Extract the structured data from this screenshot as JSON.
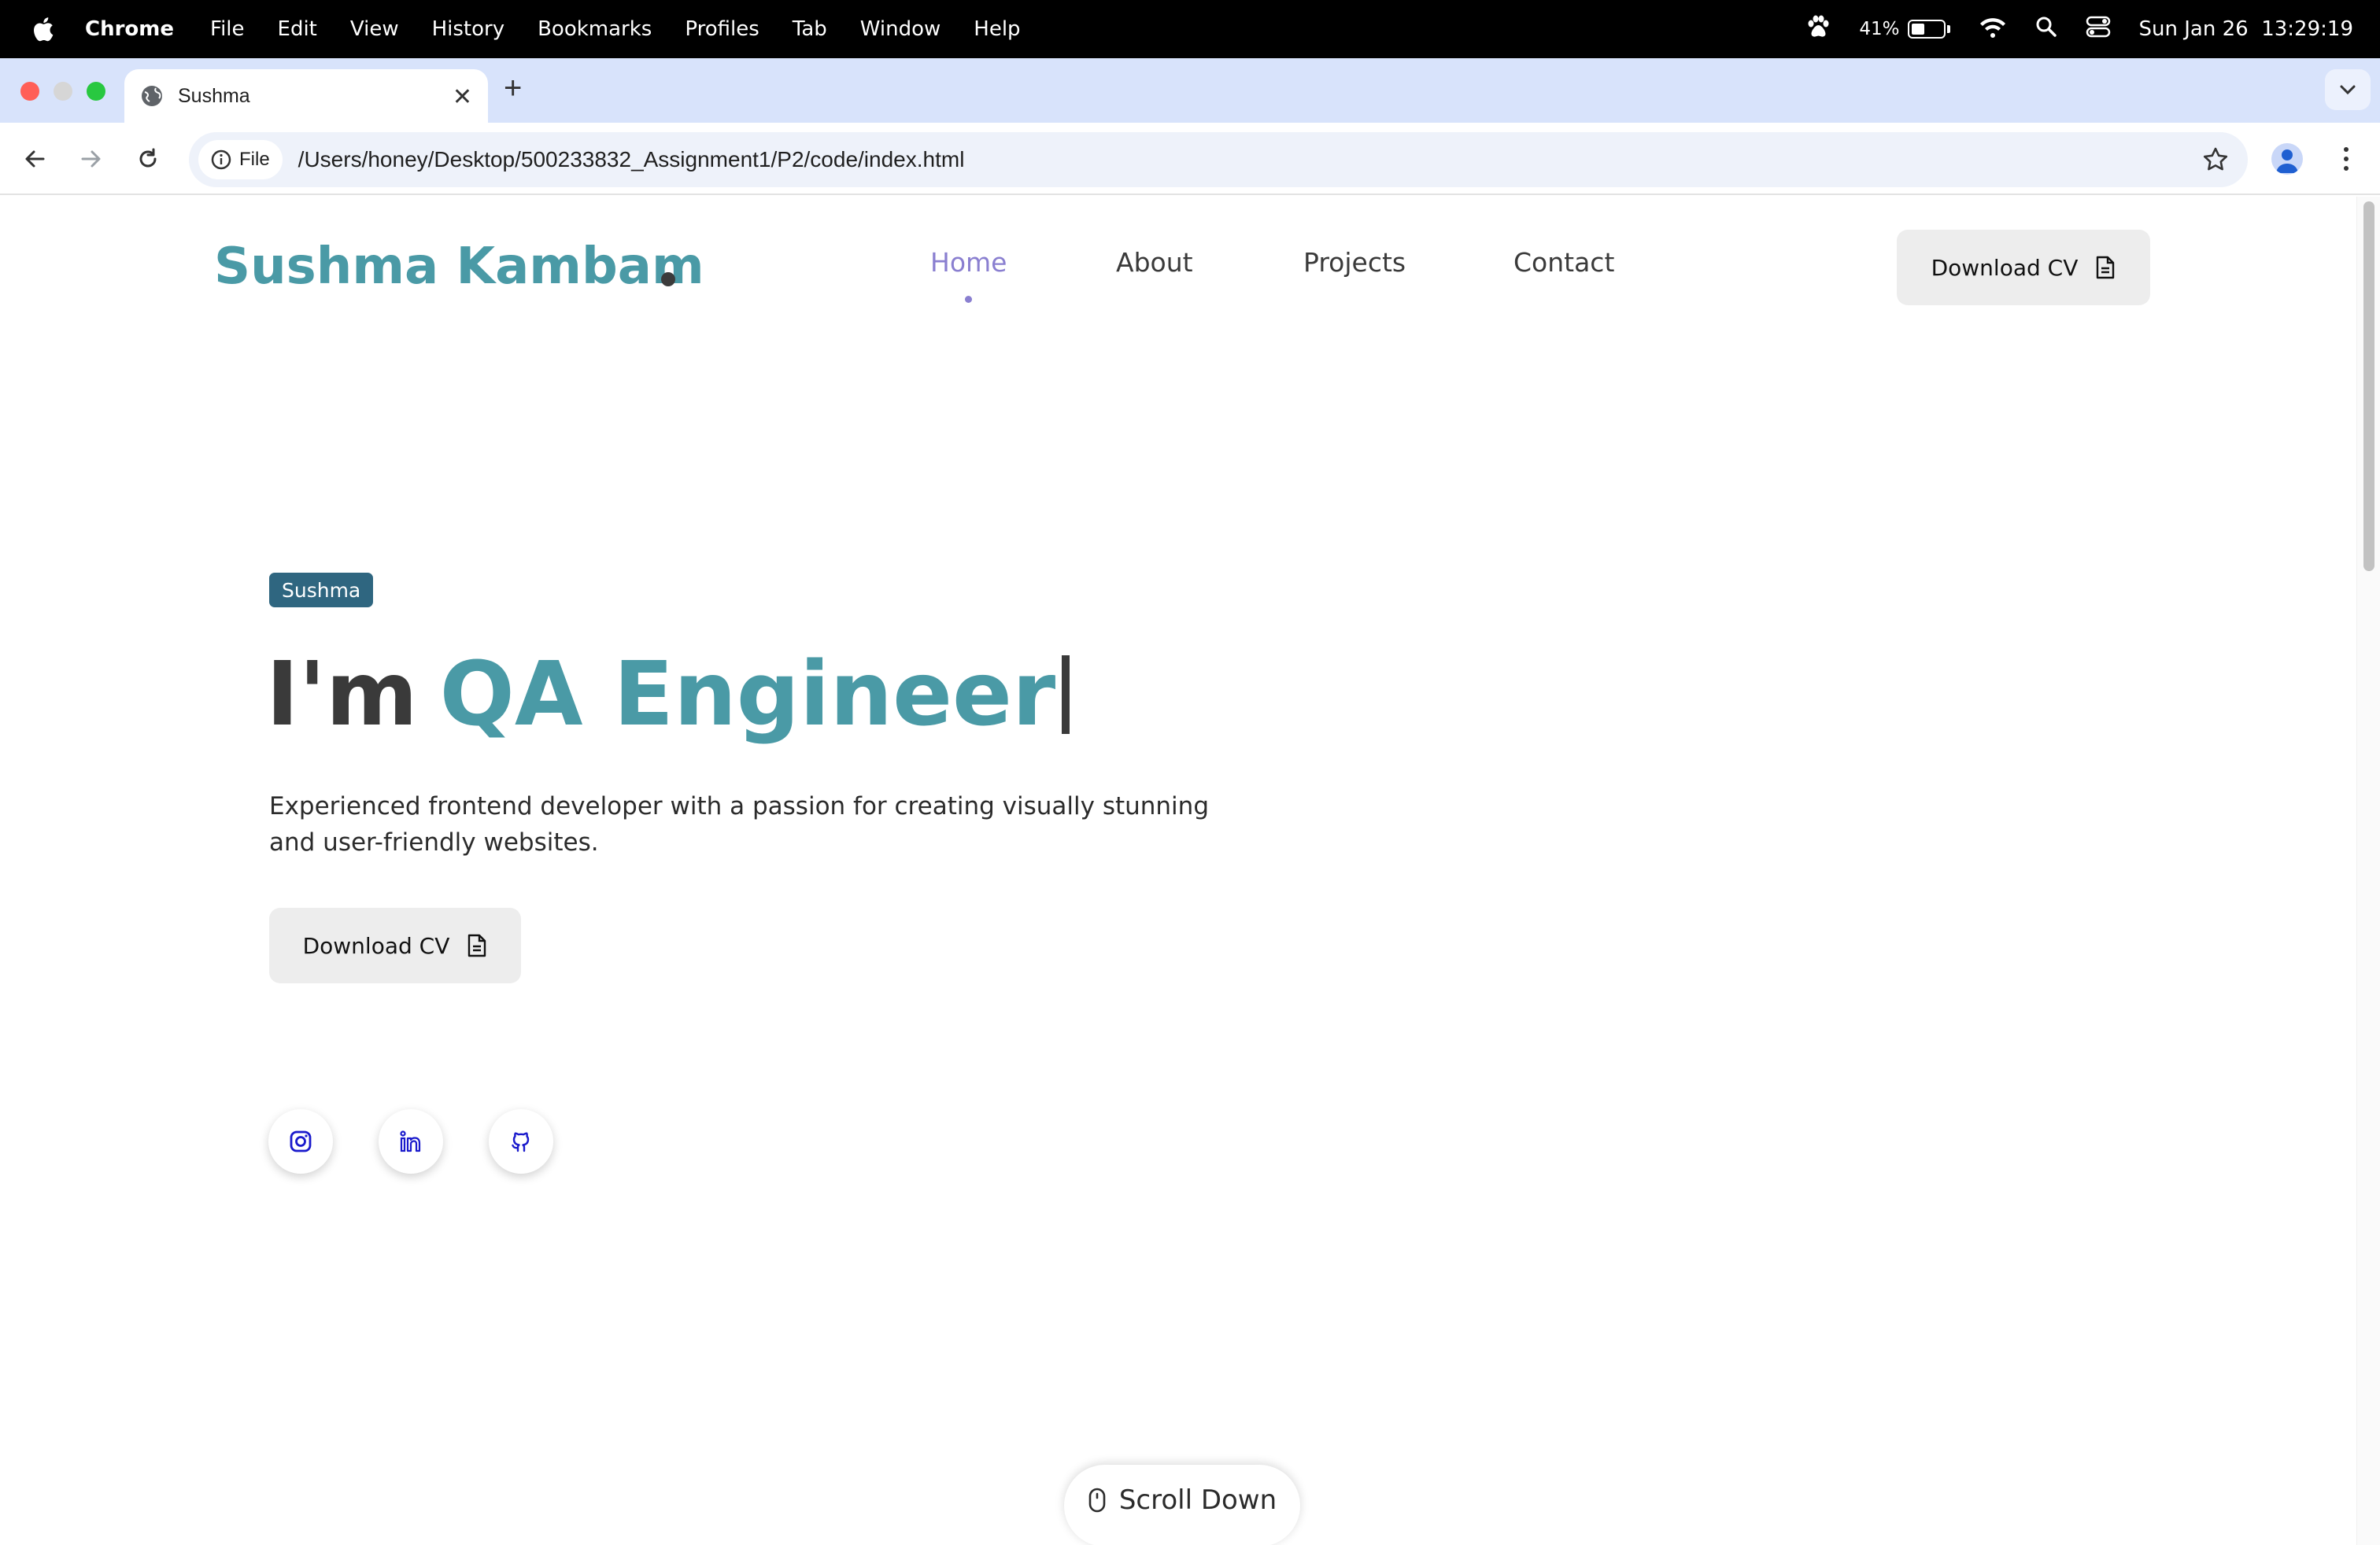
{
  "menubar": {
    "app_name": "Chrome",
    "items": [
      "File",
      "Edit",
      "View",
      "History",
      "Bookmarks",
      "Profiles",
      "Tab",
      "Window",
      "Help"
    ],
    "battery_percent": "41%",
    "battery_level": 0.41,
    "datetime": "Sun Jan 26  13:29:19"
  },
  "browser": {
    "tab_title": "Sushma",
    "chip_label": "File",
    "url": "/Users/honey/Desktop/500233832_Assignment1/P2/code/index.html"
  },
  "page": {
    "logo": "Sushma Kambam",
    "nav": [
      "Home",
      "About",
      "Projects",
      "Contact"
    ],
    "active_nav": "Home",
    "header_cta": "Download CV",
    "badge": "Sushma",
    "headline_prefix": "I'm",
    "headline_role": "QA Engineer",
    "description": "Experienced frontend developer with a passion for creating visually stunning and user-friendly websites.",
    "hero_cta": "Download CV",
    "social_icons": [
      "instagram-icon",
      "linkedin-icon",
      "github-icon"
    ],
    "scroll_label": "Scroll Down"
  },
  "colors": {
    "accent_teal": "#4a9aa6",
    "nav_active": "#8a7fd0",
    "badge_bg": "#2f6680",
    "social_icon": "#1a1acc"
  }
}
